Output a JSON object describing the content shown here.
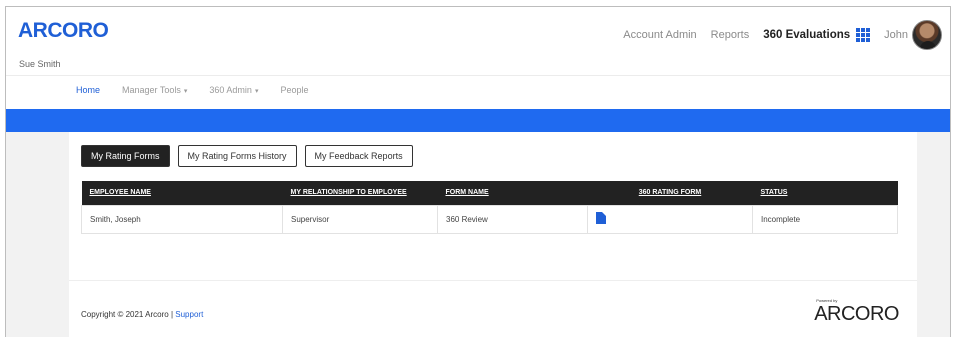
{
  "header": {
    "logo": "ARCORO",
    "user_sub": "Sue Smith",
    "nav": {
      "account_admin": "Account Admin",
      "reports": "Reports",
      "current_app": "360 Evaluations",
      "user_name": "John"
    }
  },
  "subnav": {
    "home": "Home",
    "manager_tools": "Manager Tools",
    "admin_360": "360 Admin",
    "people": "People",
    "caret": "▾"
  },
  "tabs": {
    "my_rating_forms": "My Rating Forms",
    "my_rating_forms_history": "My Rating Forms History",
    "my_feedback_reports": "My Feedback Reports"
  },
  "table": {
    "headers": [
      "EMPLOYEE NAME",
      "MY RELATIONSHIP TO EMPLOYEE",
      "FORM NAME",
      "360 RATING FORM",
      "STATUS"
    ],
    "rows": [
      {
        "employee_name": "Smith, Joseph",
        "relationship": "Supervisor",
        "form_name": "360 Review",
        "rating_form_icon": "document-icon",
        "status": "Incomplete"
      }
    ]
  },
  "footer": {
    "copyright": "Copyright © 2021 Arcoro |",
    "support": "Support",
    "powered_by": "Powered by",
    "logo": "ARCORO"
  },
  "colors": {
    "accent": "#1f5fd6",
    "bar": "#1f6af0",
    "table_header": "#222222"
  }
}
